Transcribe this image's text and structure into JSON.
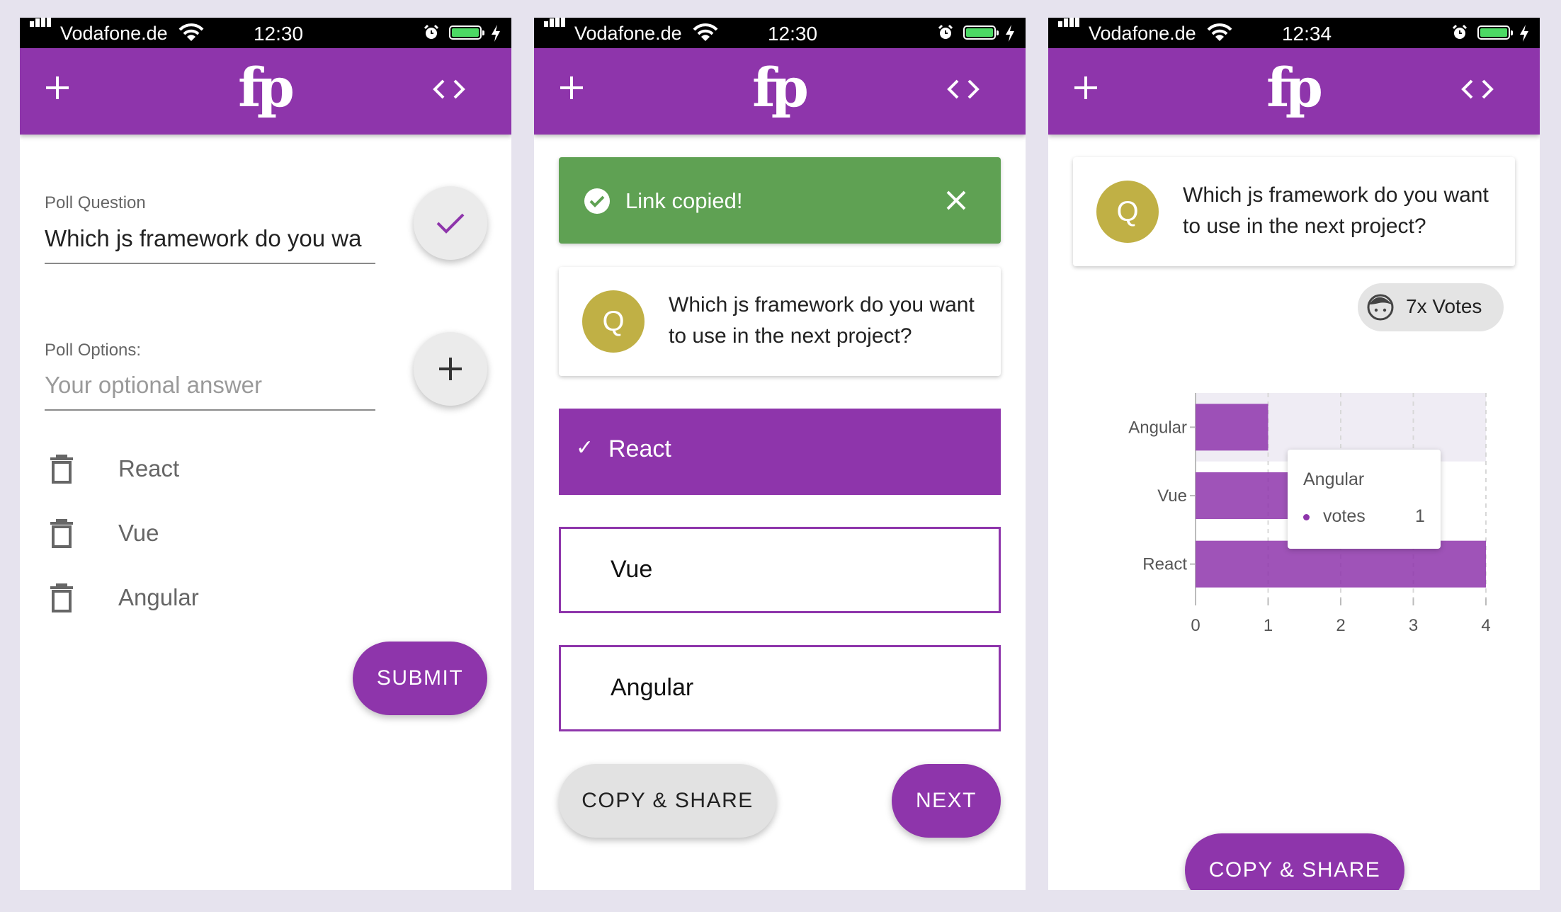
{
  "status_bars": [
    {
      "carrier": "Vodafone.de",
      "time": "12:30"
    },
    {
      "carrier": "Vodafone.de",
      "time": "12:30"
    },
    {
      "carrier": "Vodafone.de",
      "time": "12:34"
    }
  ],
  "app": {
    "logo": "fp",
    "accent": "#8e35ab",
    "toast_green": "#5fa153",
    "avatar_color": "#c0b045"
  },
  "create": {
    "question_label": "Poll Question",
    "question_value": "Which js framework do you wa",
    "options_label": "Poll Options:",
    "option_placeholder": "Your optional answer",
    "options": [
      "React",
      "Vue",
      "Angular"
    ],
    "submit": "SUBMIT"
  },
  "vote": {
    "toast": "Link copied!",
    "avatar": "Q",
    "question": "Which js framework do you want to use in the next project?",
    "choices": [
      {
        "label": "React",
        "selected": true
      },
      {
        "label": "Vue",
        "selected": false
      },
      {
        "label": "Angular",
        "selected": false
      }
    ],
    "copy_share": "COPY & SHARE",
    "next": "NEXT"
  },
  "results": {
    "avatar": "Q",
    "question": "Which js framework do you want to use in the next project?",
    "votes_badge": "7x Votes",
    "tooltip": {
      "title": "Angular",
      "series": "votes",
      "value": "1"
    },
    "copy_share": "COPY & SHARE"
  },
  "chart_data": {
    "type": "bar",
    "orientation": "horizontal",
    "categories": [
      "Angular",
      "Vue",
      "React"
    ],
    "series": [
      {
        "name": "votes",
        "values": [
          1,
          2,
          4
        ]
      }
    ],
    "xlim": [
      0,
      4
    ],
    "xticks": [
      0,
      1,
      2,
      3,
      4
    ],
    "grid": true,
    "highlighted_category": "Angular"
  }
}
